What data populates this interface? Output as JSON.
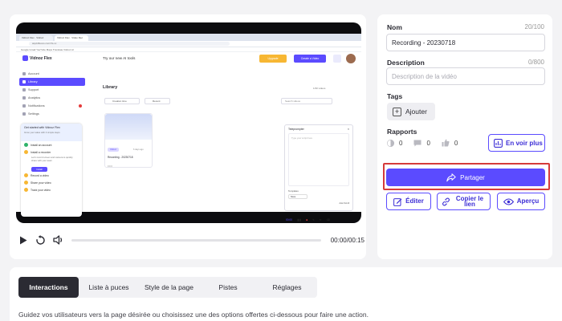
{
  "colors": {
    "accent": "#5b4bff",
    "highlight": "#d63a3a",
    "dark_tab": "#2b2b33"
  },
  "recording_ui": {
    "browser_tabs": [
      "Vidnoz Flex · Vidnoz",
      "Vidnoz Flex · Video Rec"
    ],
    "address": "aiqvidflexos.com/rfs-vx",
    "bookmarks": "Google   Gmail   YouTube   Maps   Translate   Vidnoz AI",
    "app_name": "Vidnoz Flex",
    "ai_tools_text": "Try our new AI tools",
    "upgrade_label": "Upgrade",
    "create_label": "Create a Video",
    "sidebar": [
      "Account",
      "Library",
      "Support",
      "Analytics",
      "Notifications",
      "Settings"
    ],
    "getting_started": {
      "title": "Get started with Vidnoz Flex",
      "subtitle": "Grow your sales with 4 simple steps",
      "steps": [
        "Install an account",
        "Install a recorder",
        "Record a video",
        "Share your video",
        "Track your video"
      ],
      "body": "Let's record screen and camera to quickly share with your team",
      "button": "Install"
    },
    "library_title": "Library",
    "library_count": "1/30 videos",
    "filter_1": "Creation time",
    "filter_2": "Recent",
    "search_placeholder": "Search videos",
    "card": {
      "badge": "Vidnoz",
      "date": "6 days ago",
      "name": "Recording - 20230718",
      "meta": "0  0  0"
    },
    "teleprompter": {
      "title": "Teleprompter",
      "placeholder": "Type your script here",
      "templates_label": "Templates",
      "select_value": "None",
      "auto_scroll": "Auto Scroll"
    },
    "rec_time": "00:00"
  },
  "player": {
    "time": "00:00/00:15",
    "progress": 0
  },
  "details": {
    "name_label": "Nom",
    "name_counter": "20/100",
    "name_value": "Recording - 20230718",
    "description_label": "Description",
    "description_counter": "0/800",
    "description_placeholder": "Description de la vidéo",
    "tags_label": "Tags",
    "add_tag_label": "Ajouter",
    "reports_label": "Rapports",
    "stats": {
      "views": "0",
      "comments": "0",
      "likes": "0"
    },
    "see_more_label": "En voir plus",
    "share_label": "Partager",
    "edit_label": "Éditer",
    "copy_link_label": "Copier le lien",
    "preview_label": "Aperçu"
  },
  "tabs": [
    "Interactions",
    "Liste à puces",
    "Style de la page",
    "Pistes",
    "Réglages"
  ],
  "active_tab": "Interactions",
  "guide_text": "Guidez vos utilisateurs vers la page désirée ou choisissez une des options offertes ci-dessous pour faire une action."
}
